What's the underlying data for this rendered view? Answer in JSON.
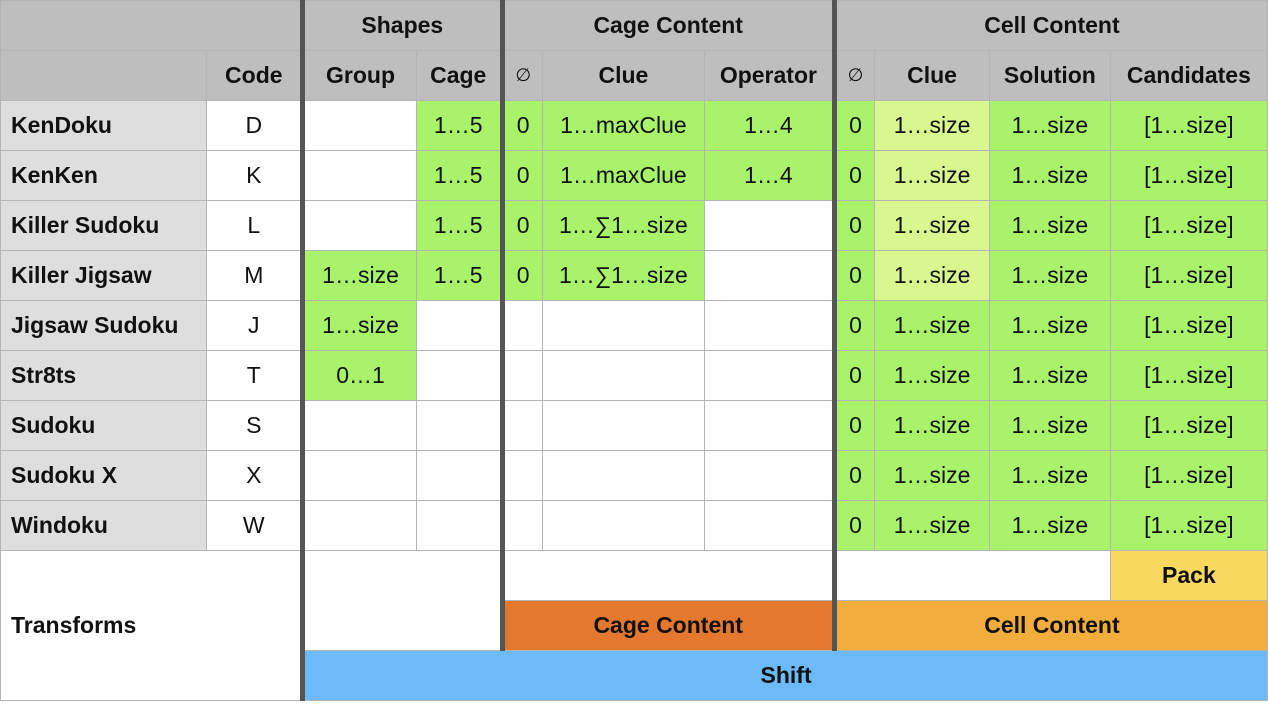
{
  "groups": {
    "shapes": "Shapes",
    "cage_content": "Cage Content",
    "cell_content": "Cell Content"
  },
  "columns": {
    "code": "Code",
    "group": "Group",
    "cage": "Cage",
    "cage_empty": "∅",
    "cage_clue": "Clue",
    "operator": "Operator",
    "cell_empty": "∅",
    "cell_clue": "Clue",
    "solution": "Solution",
    "candidates": "Candidates"
  },
  "rows": [
    {
      "name": "KenDoku",
      "code": "D",
      "group": "",
      "cage": "1…5",
      "cage_empty": "0",
      "cage_clue": "1…maxClue",
      "operator": "1…4",
      "cell_empty": "0",
      "cell_clue": "1…size",
      "solution": "1…size",
      "candidates": "[1…size]"
    },
    {
      "name": "KenKen",
      "code": "K",
      "group": "",
      "cage": "1…5",
      "cage_empty": "0",
      "cage_clue": "1…maxClue",
      "operator": "1…4",
      "cell_empty": "0",
      "cell_clue": "1…size",
      "solution": "1…size",
      "candidates": "[1…size]"
    },
    {
      "name": "Killer Sudoku",
      "code": "L",
      "group": "",
      "cage": "1…5",
      "cage_empty": "0",
      "cage_clue": "1…∑1…size",
      "operator": "",
      "cell_empty": "0",
      "cell_clue": "1…size",
      "solution": "1…size",
      "candidates": "[1…size]"
    },
    {
      "name": "Killer Jigsaw",
      "code": "M",
      "group": "1…size",
      "cage": "1…5",
      "cage_empty": "0",
      "cage_clue": "1…∑1…size",
      "operator": "",
      "cell_empty": "0",
      "cell_clue": "1…size",
      "solution": "1…size",
      "candidates": "[1…size]"
    },
    {
      "name": "Jigsaw Sudoku",
      "code": "J",
      "group": "1…size",
      "cage": "",
      "cage_empty": "",
      "cage_clue": "",
      "operator": "",
      "cell_empty": "0",
      "cell_clue": "1…size",
      "solution": "1…size",
      "candidates": "[1…size]"
    },
    {
      "name": "Str8ts",
      "code": "T",
      "group": "0…1",
      "cage": "",
      "cage_empty": "",
      "cage_clue": "",
      "operator": "",
      "cell_empty": "0",
      "cell_clue": "1…size",
      "solution": "1…size",
      "candidates": "[1…size]"
    },
    {
      "name": "Sudoku",
      "code": "S",
      "group": "",
      "cage": "",
      "cage_empty": "",
      "cage_clue": "",
      "operator": "",
      "cell_empty": "0",
      "cell_clue": "1…size",
      "solution": "1…size",
      "candidates": "[1…size]"
    },
    {
      "name": "Sudoku X",
      "code": "X",
      "group": "",
      "cage": "",
      "cage_empty": "",
      "cage_clue": "",
      "operator": "",
      "cell_empty": "0",
      "cell_clue": "1…size",
      "solution": "1…size",
      "candidates": "[1…size]"
    },
    {
      "name": "Windoku",
      "code": "W",
      "group": "",
      "cage": "",
      "cage_empty": "",
      "cage_clue": "",
      "operator": "",
      "cell_empty": "0",
      "cell_clue": "1…size",
      "solution": "1…size",
      "candidates": "[1…size]"
    }
  ],
  "transforms": {
    "label": "Transforms",
    "pack": "Pack",
    "cage_content": "Cage Content",
    "cell_content": "Cell Content",
    "shift": "Shift"
  },
  "colors": {
    "header_gray": "#bdbebd",
    "row_name_gray": "#dedede",
    "green": "#a8f36a",
    "light_green": "#d8f88f",
    "pack_yellow": "#f9d85f",
    "cage_orange": "#e4782f",
    "cell_orange": "#f1ae3d",
    "shift_blue": "#6cbbf8"
  }
}
